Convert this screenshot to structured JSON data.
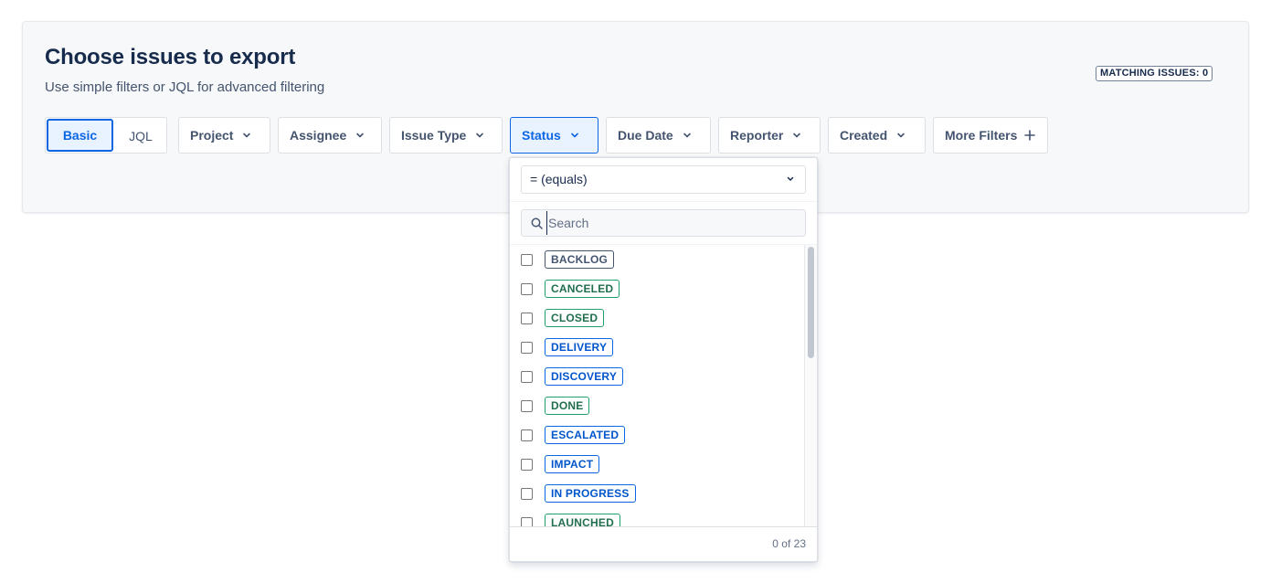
{
  "header": {
    "title": "Choose issues to export",
    "subtitle": "Use simple filters or JQL for advanced filtering",
    "matching_label": "MATCHING ISSUES: 0"
  },
  "mode_toggle": {
    "basic_label": "Basic",
    "jql_label": "JQL",
    "selected": "Basic"
  },
  "filters": [
    {
      "label": "Project",
      "icon": "chevron-down-icon"
    },
    {
      "label": "Assignee",
      "icon": "chevron-down-icon"
    },
    {
      "label": "Issue Type",
      "icon": "chevron-down-icon"
    },
    {
      "label": "Status",
      "icon": "chevron-down-icon",
      "active": true
    },
    {
      "label": "Due Date",
      "icon": "chevron-down-icon"
    },
    {
      "label": "Reporter",
      "icon": "chevron-down-icon"
    },
    {
      "label": "Created",
      "icon": "chevron-down-icon"
    },
    {
      "label": "More Filters",
      "icon": "plus-icon"
    }
  ],
  "status_dropdown": {
    "operator_value": "= (equals)",
    "search_placeholder": "Search",
    "options": [
      {
        "label": "BACKLOG",
        "color": "grey",
        "checked": false
      },
      {
        "label": "CANCELED",
        "color": "green",
        "checked": false
      },
      {
        "label": "CLOSED",
        "color": "green",
        "checked": false
      },
      {
        "label": "DELIVERY",
        "color": "blue",
        "checked": false
      },
      {
        "label": "DISCOVERY",
        "color": "blue",
        "checked": false
      },
      {
        "label": "DONE",
        "color": "green",
        "checked": false
      },
      {
        "label": "ESCALATED",
        "color": "blue",
        "checked": false
      },
      {
        "label": "IMPACT",
        "color": "blue",
        "checked": false
      },
      {
        "label": "IN PROGRESS",
        "color": "blue",
        "checked": false
      },
      {
        "label": "LAUNCHED",
        "color": "green",
        "checked": false
      }
    ],
    "count_label": "0 of 23"
  },
  "colors": {
    "accent": "#0c66e4",
    "accent_bg": "#e9f2ff",
    "lozenge_grey": "#44546f",
    "lozenge_green": "#216e4e",
    "lozenge_blue": "#0055cc"
  }
}
